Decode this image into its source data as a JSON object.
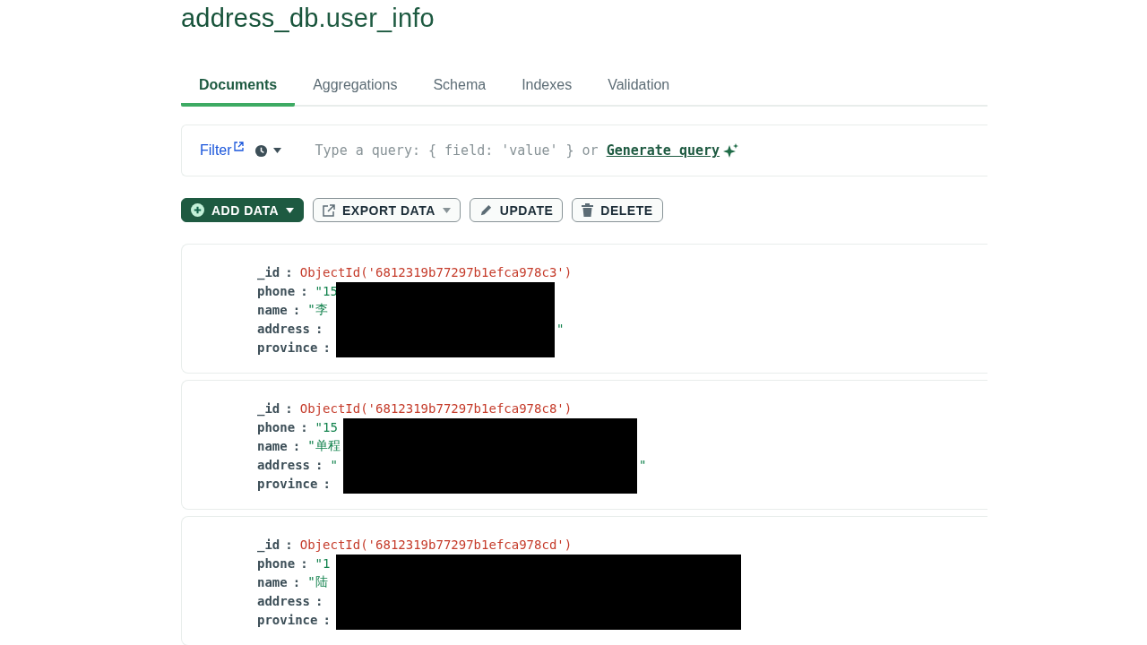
{
  "title": {
    "database": "address_db",
    "collection": ".user_info"
  },
  "tabs": [
    {
      "label": "Documents",
      "selected": true
    },
    {
      "label": "Aggregations",
      "selected": false
    },
    {
      "label": "Schema",
      "selected": false
    },
    {
      "label": "Indexes",
      "selected": false
    },
    {
      "label": "Validation",
      "selected": false
    }
  ],
  "filter": {
    "label": "Filter",
    "placeholder": "Type a query: { field: 'value' } or",
    "link": "Generate query"
  },
  "actions": [
    {
      "kind": "primary",
      "label": "ADD DATA",
      "caret": true
    },
    {
      "kind": "export",
      "label": "EXPORT DATA",
      "caret": true
    },
    {
      "kind": "update",
      "label": "UPDATE",
      "caret": false
    },
    {
      "kind": "delete",
      "label": "DELETE",
      "caret": false
    }
  ],
  "documents": [
    {
      "fields": [
        {
          "key": "_id",
          "sep": ":",
          "value": "ObjectId('6812319b77297b1efca978c3')",
          "kind": "oid"
        },
        {
          "key": "phone",
          "sep": ":",
          "value": "\"15",
          "kind": "str"
        },
        {
          "key": "name",
          "sep": ":",
          "value": "\"李",
          "kind": "str"
        },
        {
          "key": "address",
          "sep": ":",
          "tail": "\""
        },
        {
          "key": "province",
          "sep": ":"
        }
      ]
    },
    {
      "fields": [
        {
          "key": "_id",
          "sep": ":",
          "value": "ObjectId('6812319b77297b1efca978c8')",
          "kind": "oid"
        },
        {
          "key": "phone",
          "sep": ":",
          "value": "\"15",
          "kind": "str"
        },
        {
          "key": "name",
          "sep": ":",
          "value": "\"单程",
          "kind": "str"
        },
        {
          "key": "address",
          "sep": ":",
          "value": "\"",
          "kind": "str",
          "tail": "\""
        },
        {
          "key": "province",
          "sep": ":"
        }
      ]
    },
    {
      "fields": [
        {
          "key": "_id",
          "sep": ":",
          "value": "ObjectId('6812319b77297b1efca978cd')",
          "kind": "oid"
        },
        {
          "key": "phone",
          "sep": ":",
          "value": "\"1",
          "kind": "str"
        },
        {
          "key": "name",
          "sep": ":",
          "value": "\"陆",
          "kind": "str"
        },
        {
          "key": "address",
          "sep": ":"
        },
        {
          "key": "province",
          "sep": ":"
        }
      ]
    }
  ]
}
